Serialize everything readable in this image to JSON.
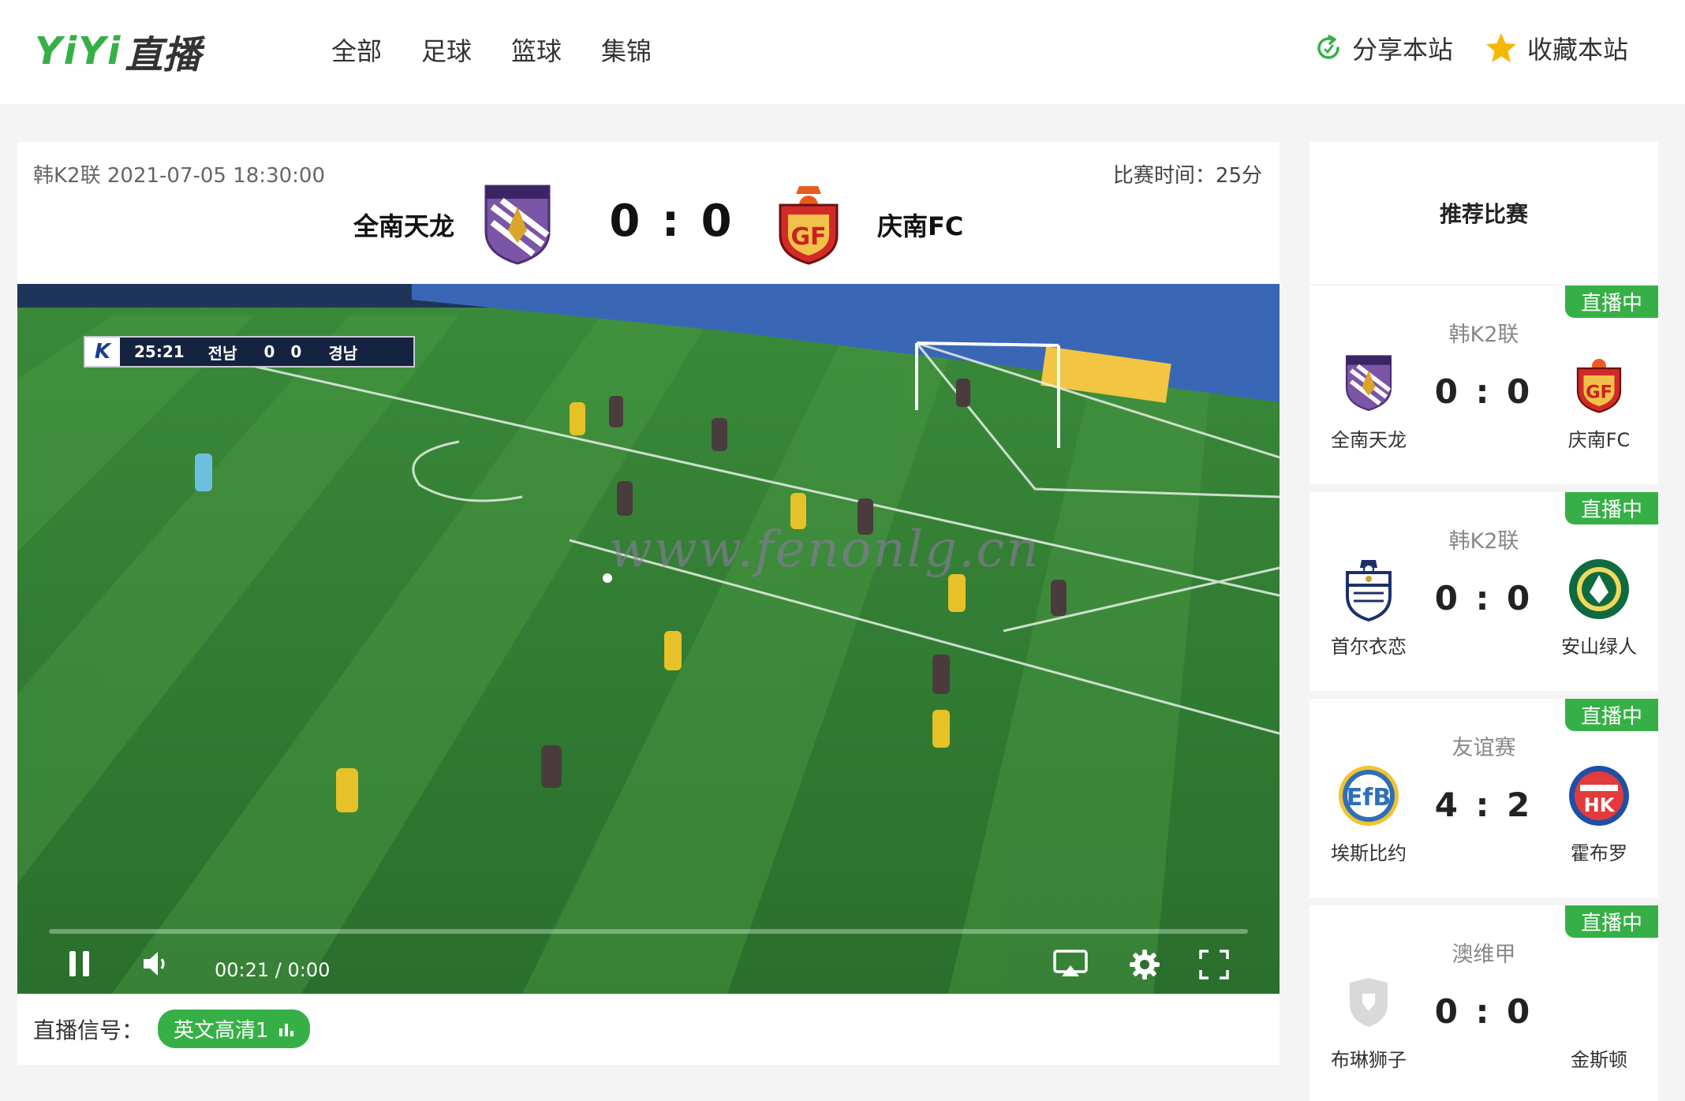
{
  "header": {
    "logo_text": "YiYi",
    "logo_cn": "直播",
    "nav": [
      "全部",
      "足球",
      "篮球",
      "集锦"
    ],
    "share_label": "分享本站",
    "favorite_label": "收藏本站"
  },
  "match": {
    "league_datetime": "韩K2联 2021-07-05 18:30:00",
    "match_time": "比赛时间：25分",
    "home_team": "全南天龙",
    "away_team": "庆南FC",
    "score": "0 : 0"
  },
  "video": {
    "hud_clock": "25:21",
    "hud_home": "전남",
    "hud_home_score": "0",
    "hud_away_score": "0",
    "hud_away": "경남",
    "watermark": "www.fenonlg.cn",
    "time_readout": "00:21 / 0:00",
    "progress": 0.0
  },
  "signal": {
    "label": "直播信号：",
    "source": "英文高清1"
  },
  "sidebar": {
    "title": "推荐比赛",
    "matches": [
      {
        "badge": "直播中",
        "league": "韩K2联",
        "home": "全南天龙",
        "away": "庆南FC",
        "score": "0 : 0"
      },
      {
        "badge": "直播中",
        "league": "韩K2联",
        "home": "首尔衣恋",
        "away": "安山绿人",
        "score": "0 : 0"
      },
      {
        "badge": "直播中",
        "league": "友谊赛",
        "home": "埃斯比约",
        "away": "霍布罗",
        "score": "4 : 2"
      },
      {
        "badge": "直播中",
        "league": "澳维甲",
        "home": "布琳狮子",
        "away": "金斯顿",
        "score": "0 : 0"
      }
    ]
  },
  "colors": {
    "accent": "#36b046",
    "star": "#f5b800"
  }
}
